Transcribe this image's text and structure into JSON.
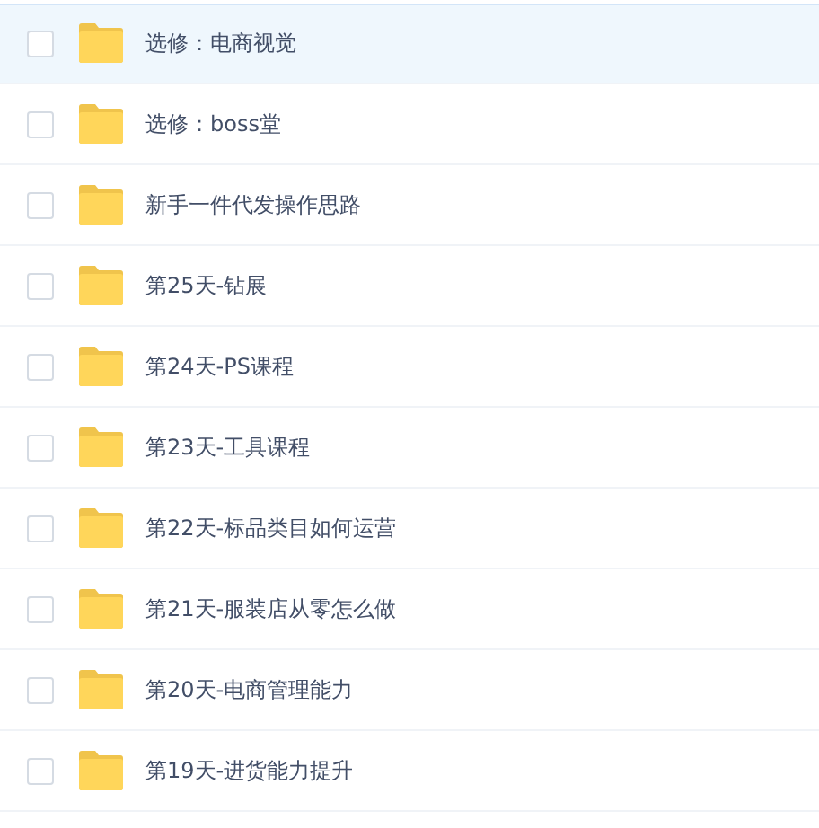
{
  "files": [
    {
      "name": "选修：电商视觉",
      "selected": true,
      "checked": false
    },
    {
      "name": "选修：boss堂",
      "selected": false,
      "checked": false
    },
    {
      "name": "新手一件代发操作思路",
      "selected": false,
      "checked": false
    },
    {
      "name": "第25天-钻展",
      "selected": false,
      "checked": false
    },
    {
      "name": "第24天-PS课程",
      "selected": false,
      "checked": false
    },
    {
      "name": "第23天-工具课程",
      "selected": false,
      "checked": false
    },
    {
      "name": "第22天-标品类目如何运营",
      "selected": false,
      "checked": false
    },
    {
      "name": "第21天-服装店从零怎么做",
      "selected": false,
      "checked": false
    },
    {
      "name": "第20天-电商管理能力",
      "selected": false,
      "checked": false
    },
    {
      "name": "第19天-进货能力提升",
      "selected": false,
      "checked": false
    }
  ]
}
